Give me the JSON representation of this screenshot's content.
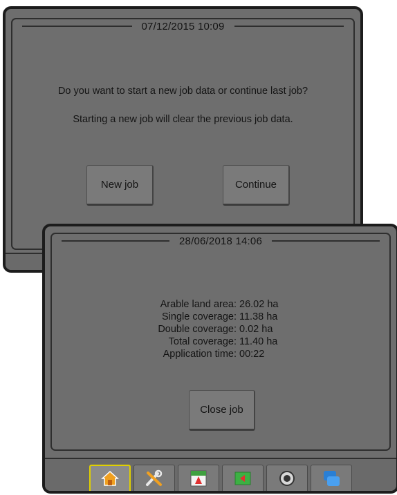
{
  "start_dialog": {
    "datetime": "07/12/2015 10:09",
    "message_line1": "Do you want to start a new job data or continue last job?",
    "message_line2": "Starting a new job will clear the previous job data.",
    "new_job_label": "New job",
    "continue_label": "Continue"
  },
  "close_dialog": {
    "datetime": "28/06/2018 14:06",
    "stats": [
      {
        "label": "Arable land area:",
        "value": "26.02 ha"
      },
      {
        "label": "Single coverage:",
        "value": "11.38 ha"
      },
      {
        "label": "Double coverage:",
        "value": "0.02 ha"
      },
      {
        "label": "Total coverage:",
        "value": "11.40 ha"
      },
      {
        "label": "Application time:",
        "value": "00:22"
      }
    ],
    "close_job_label": "Close job"
  },
  "toolbar": {
    "active_tab": "home",
    "tabs": [
      "home-icon",
      "tools-icon",
      "field-map-icon",
      "guidance-icon",
      "camera-icon",
      "data-transfer-icon"
    ]
  },
  "colors": {
    "screen_bg": "#6e6e6e",
    "bezel": "#1c1c1c",
    "active_tab_outline": "#e0d000"
  }
}
